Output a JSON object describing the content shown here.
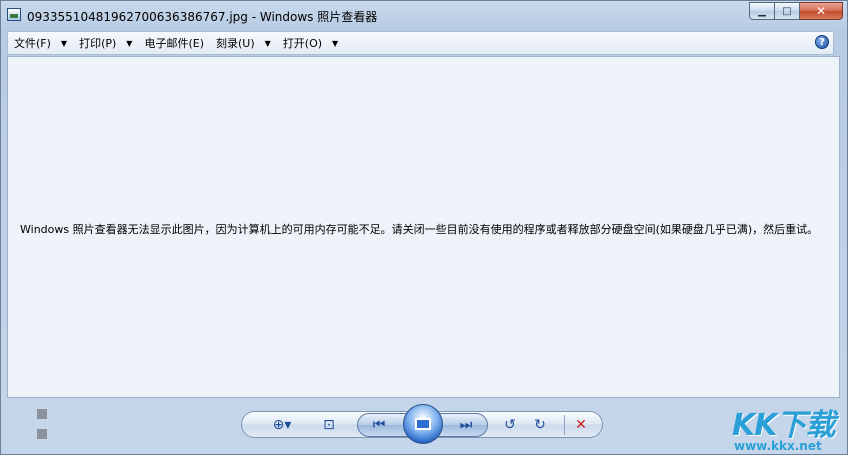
{
  "window": {
    "title": "093355104819627006363867​67.jpg - Windows 照片查看器",
    "minimize_glyph": "▁",
    "maximize_glyph": "□",
    "close_glyph": "✕"
  },
  "menubar": {
    "items": [
      {
        "label": "文件(F)",
        "has_arrow": true
      },
      {
        "label": "打印(P)",
        "has_arrow": true
      },
      {
        "label": "电子邮件(E)",
        "has_arrow": false
      },
      {
        "label": "刻录(U)",
        "has_arrow": true
      },
      {
        "label": "打开(O)",
        "has_arrow": true
      }
    ],
    "arrow_glyph": "▼",
    "help_glyph": "?"
  },
  "viewer": {
    "message": "Windows 照片查看器无法显示此图片，因为计算机上的可用内存可能不足。请关闭一些目前没有使用的程序或者释放部分硬盘空间(如果硬盘几乎已满)，然后重试。"
  },
  "controls": {
    "zoom_icon": "⊕▾",
    "actual_size_icon": "⊡",
    "previous_icon": "⏮",
    "next_icon": "⏭",
    "rotate_ccw_icon": "↺",
    "rotate_cw_icon": "↻",
    "delete_icon": "✕"
  },
  "background_files": {
    "items": [
      "",
      "",
      ""
    ]
  },
  "watermark": {
    "logo": "KK下载",
    "url": "www.kkx.net"
  },
  "colors": {
    "accent": "#1e4d99",
    "delete": "#c8211b",
    "watermark": "#2a9fd8"
  }
}
